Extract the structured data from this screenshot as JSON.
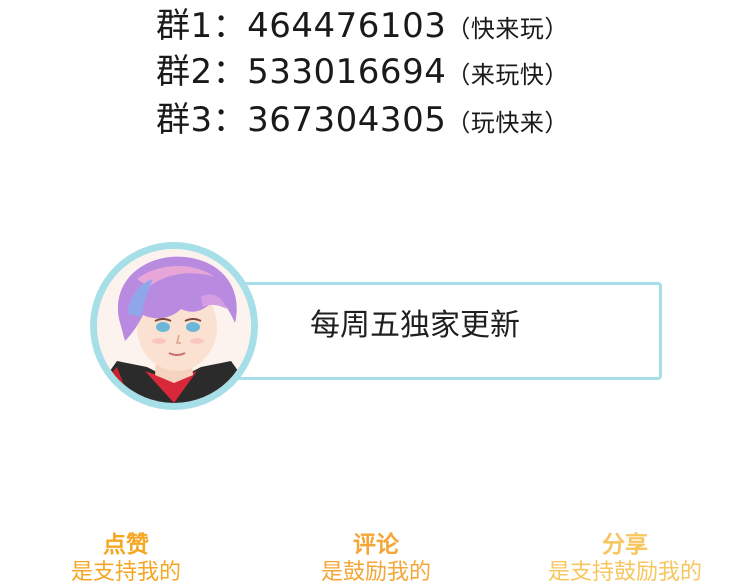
{
  "groups": [
    {
      "label": "群1：",
      "number": "464476103",
      "note": "（快来玩）"
    },
    {
      "label": "群2：",
      "number": "533016694",
      "note": "（来玩快）"
    },
    {
      "label": "群3：",
      "number": "367304305",
      "note": "（玩快来）"
    }
  ],
  "update_notice": "每周五独家更新",
  "actions": [
    {
      "title": "点赞",
      "subtitle": "是支持我的"
    },
    {
      "title": "评论",
      "subtitle": "是鼓励我的"
    },
    {
      "title": "分享",
      "subtitle": "是支持鼓励我的"
    }
  ],
  "colors": {
    "accent_border": "#a7dfe8",
    "like": "#f5a623",
    "comment": "#f4a637",
    "share": "#f7c65f"
  }
}
